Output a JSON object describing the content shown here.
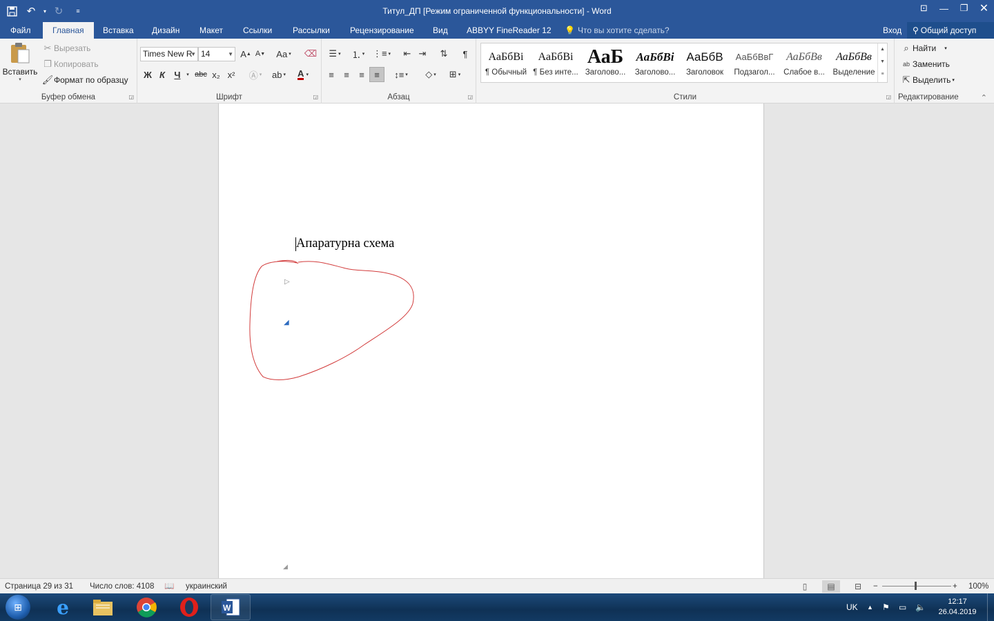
{
  "window": {
    "title": "Титул_ДП [Режим ограниченной функциональности] - Word"
  },
  "colors": {
    "brand": "#2b579a",
    "ink": "#d23b3b",
    "anchor": "#2e6cc0"
  },
  "tabs": [
    {
      "label": "Файл"
    },
    {
      "label": "Главная"
    },
    {
      "label": "Вставка"
    },
    {
      "label": "Дизайн"
    },
    {
      "label": "Макет"
    },
    {
      "label": "Ссылки"
    },
    {
      "label": "Рассылки"
    },
    {
      "label": "Рецензирование"
    },
    {
      "label": "Вид"
    },
    {
      "label": "ABBYY FineReader 12"
    }
  ],
  "tellme": "Что вы хотите сделать?",
  "signin": "Вход",
  "share": "Общий доступ",
  "clipboard": {
    "paste": "Вставить",
    "cut": "Вырезать",
    "copy": "Копировать",
    "format_painter": "Формат по образцу",
    "label": "Буфер обмена"
  },
  "font": {
    "name": "Times New R",
    "size": "14",
    "label": "Шрифт",
    "bold": "Ж",
    "italic": "К",
    "underline": "Ч",
    "strike": "abc",
    "subscript": "x₂",
    "superscript": "x²",
    "grow": "A",
    "shrink": "A",
    "case": "Aa",
    "font_color": "A"
  },
  "paragraph": {
    "label": "Абзац"
  },
  "styles": {
    "label": "Стили",
    "items": [
      {
        "sample": "АаБбВі",
        "name": "¶ Обычный"
      },
      {
        "sample": "АаБбВі",
        "name": "¶ Без инте..."
      },
      {
        "sample": "АаБ",
        "name": "Заголово..."
      },
      {
        "sample": "АаБбВі",
        "name": "Заголово..."
      },
      {
        "sample": "АаБбВ",
        "name": "Заголовок"
      },
      {
        "sample": "АаБбВвГ",
        "name": "Подзагол..."
      },
      {
        "sample": "АаБбВв",
        "name": "Слабое в..."
      },
      {
        "sample": "АаБбВв",
        "name": "Выделение"
      }
    ]
  },
  "editing": {
    "label": "Редактирование",
    "find": "Найти",
    "replace": "Заменить",
    "select": "Выделить"
  },
  "document": {
    "text": "Апаратурна схема"
  },
  "status": {
    "page": "Страница 29 из 31",
    "words": "Число слов: 4108",
    "language": "украинский",
    "zoom": "100%",
    "zoom_level": 1.0
  },
  "taskbar": {
    "lang": "UK",
    "time": "12:17",
    "date": "26.04.2019",
    "apps": [
      {
        "name": "internet-explorer"
      },
      {
        "name": "file-explorer"
      },
      {
        "name": "chrome"
      },
      {
        "name": "opera"
      },
      {
        "name": "word"
      }
    ]
  }
}
